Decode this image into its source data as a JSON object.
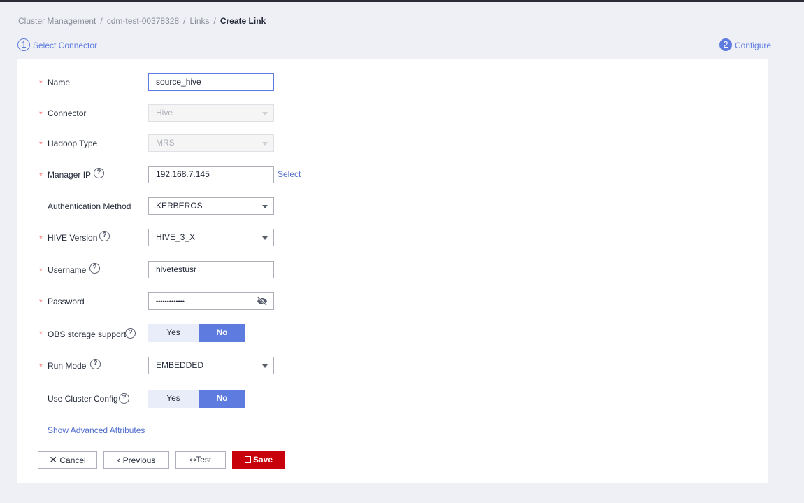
{
  "breadcrumb": [
    "Cluster Management",
    "cdm-test-00378328",
    "Links",
    "Create Link"
  ],
  "steps": [
    {
      "num": "1",
      "label": "Select Connector"
    },
    {
      "num": "2",
      "label": "Configure"
    }
  ],
  "form": {
    "name": {
      "label": "Name",
      "value": "source_hive"
    },
    "connector": {
      "label": "Connector",
      "value": "Hive"
    },
    "hadoop_type": {
      "label": "Hadoop Type",
      "value": "MRS"
    },
    "manager_ip": {
      "label": "Manager IP",
      "value": "192.168.7.145",
      "select": "Select"
    },
    "auth": {
      "label": "Authentication Method",
      "value": "KERBEROS"
    },
    "hive_version": {
      "label": "HIVE Version",
      "value": "HIVE_3_X"
    },
    "username": {
      "label": "Username",
      "value": "hivetestusr"
    },
    "password": {
      "label": "Password",
      "value": "•••••••••••••"
    },
    "obs": {
      "label": "OBS storage support",
      "yes": "Yes",
      "no": "No",
      "selected": "No"
    },
    "run_mode": {
      "label": "Run Mode",
      "value": "EMBEDDED"
    },
    "use_cluster": {
      "label": "Use Cluster Config",
      "yes": "Yes",
      "no": "No",
      "selected": "No"
    },
    "advanced": "Show Advanced Attributes"
  },
  "buttons": {
    "cancel": "Cancel",
    "previous": "Previous",
    "test": "Test",
    "save": "Save"
  },
  "colors": {
    "accent": "#5e7ce0",
    "save": "#c7000b",
    "required": "#f66f6a"
  }
}
